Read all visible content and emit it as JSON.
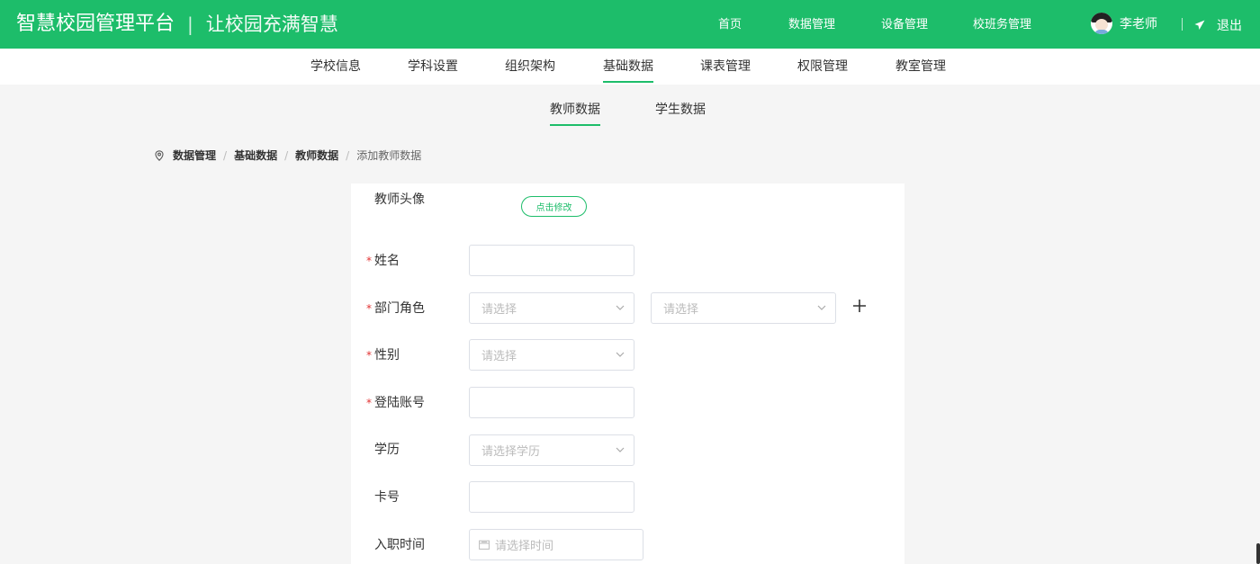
{
  "colors": {
    "brand": "#1dbd6a",
    "required": "#e23333"
  },
  "header": {
    "title": "智慧校园管理平台",
    "separator": "|",
    "slogan": "让校园充满智慧",
    "nav": [
      "首页",
      "数据管理",
      "设备管理",
      "校班务管理"
    ],
    "user_name": "李老师",
    "logout_label": "退出"
  },
  "subnav": {
    "items": [
      "学校信息",
      "学科设置",
      "组织架构",
      "基础数据",
      "课表管理",
      "权限管理",
      "教室管理"
    ],
    "active": "基础数据"
  },
  "tabs": {
    "items": [
      "教师数据",
      "学生数据"
    ],
    "active": "教师数据"
  },
  "breadcrumb": {
    "items": [
      "数据管理",
      "基础数据",
      "教师数据",
      "添加教师数据"
    ],
    "separator": "/"
  },
  "form": {
    "avatar_label": "教师头像",
    "avatar_button": "点击修改",
    "required_mark": "*",
    "name_label": "姓名",
    "dept_role_label": "部门角色",
    "dept_placeholder": "请选择",
    "role_placeholder": "请选择",
    "gender_label": "性别",
    "gender_placeholder": "请选择",
    "account_label": "登陆账号",
    "education_label": "学历",
    "education_placeholder": "请选择学历",
    "card_label": "卡号",
    "hire_date_label": "入职时间",
    "hire_date_placeholder": "请选择时间"
  }
}
